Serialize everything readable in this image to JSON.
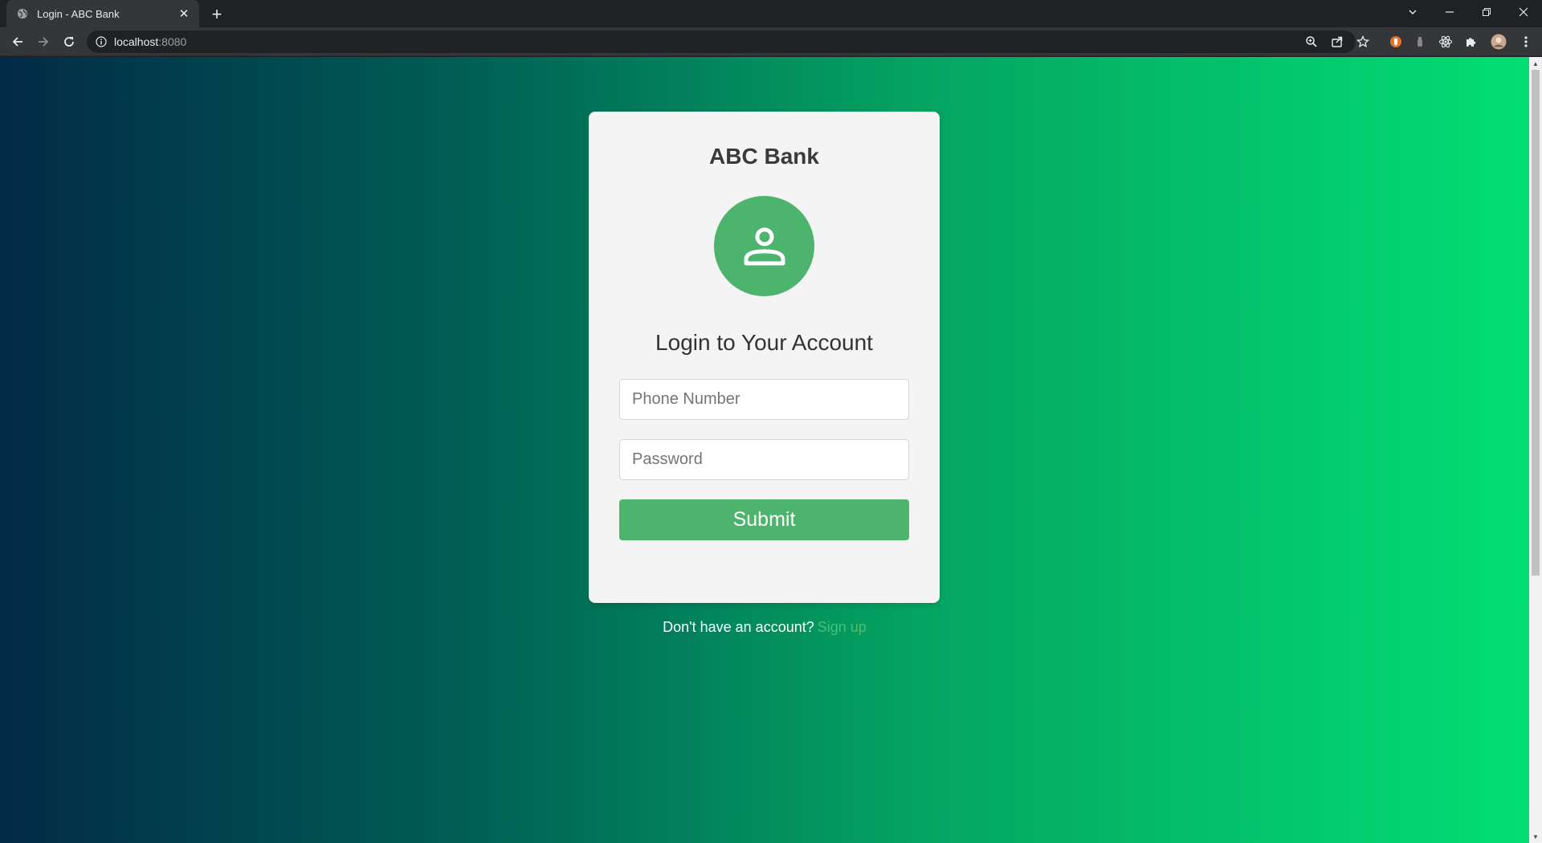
{
  "browser": {
    "tab_title": "Login - ABC Bank",
    "tab_close_glyph": "✕",
    "new_tab_glyph": "+",
    "url_host": "localhost",
    "url_port": ":8080",
    "icons": {
      "back": "back-arrow-icon",
      "forward": "forward-arrow-icon",
      "reload": "reload-icon",
      "info": "info-icon",
      "zoom": "zoom-icon",
      "share": "share-icon",
      "bookmark": "star-icon",
      "extensions": "puzzle-icon",
      "menu": "kebab-menu-icon"
    }
  },
  "page": {
    "bank_name": "ABC Bank",
    "avatar_icon": "user-icon",
    "heading": "Login to Your Account",
    "phone": {
      "value": "",
      "placeholder": "Phone Number"
    },
    "password": {
      "value": "",
      "placeholder": "Password"
    },
    "submit_label": "Submit",
    "signup_prompt": "Don't have an account?",
    "signup_link": "Sign up"
  },
  "colors": {
    "accent": "#4cb46d",
    "card": "#f4f4f4",
    "gradient_start": "#022a47",
    "gradient_end": "#03de74",
    "link": "#4cbf6e"
  }
}
